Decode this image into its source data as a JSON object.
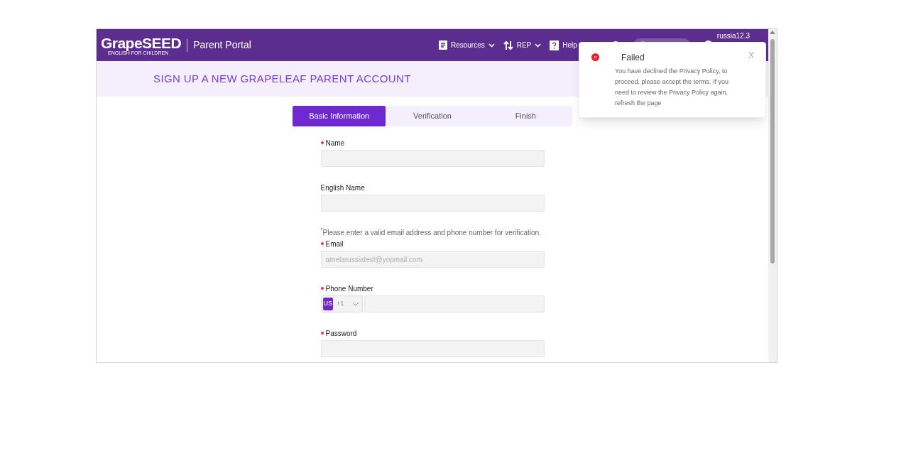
{
  "header": {
    "logo": "GrapeSEED",
    "logo_tagline": "ENGLISH FOR CHILDREN",
    "portal_title": "Parent Portal",
    "nav": [
      {
        "kind": "doc",
        "label": "Resources"
      },
      {
        "kind": "swap",
        "label": "REP"
      },
      {
        "kind": "help",
        "label": "Help"
      }
    ],
    "user": "russia12.3"
  },
  "page_title": "SIGN UP A NEW GRAPELEAF PARENT ACCOUNT",
  "steps": [
    {
      "label": "Basic Information",
      "selected": true
    },
    {
      "label": "Verification",
      "selected": false
    },
    {
      "label": "Finish",
      "selected": false
    }
  ],
  "fields": [
    {
      "kind": "text",
      "label": "Name",
      "required": true
    },
    {
      "kind": "text",
      "label": "English Name",
      "required": false
    },
    {
      "kind": "note",
      "text": "Please enter a valid email address and phone number for verification."
    },
    {
      "kind": "text",
      "label": "Email",
      "required": true,
      "value": "amelarussiatest@yopmail.com",
      "disabled": true
    },
    {
      "kind": "phone",
      "label": "Phone Number",
      "required": true,
      "country": "US",
      "code": "+1"
    },
    {
      "kind": "text",
      "label": "Password",
      "required": true
    }
  ],
  "toast": {
    "title": "Failed",
    "message": "You have declined the Privacy Policy, to proceed, please accept the terms. If you need to review the Privacy Policy again, refresh the page",
    "close": "X"
  }
}
